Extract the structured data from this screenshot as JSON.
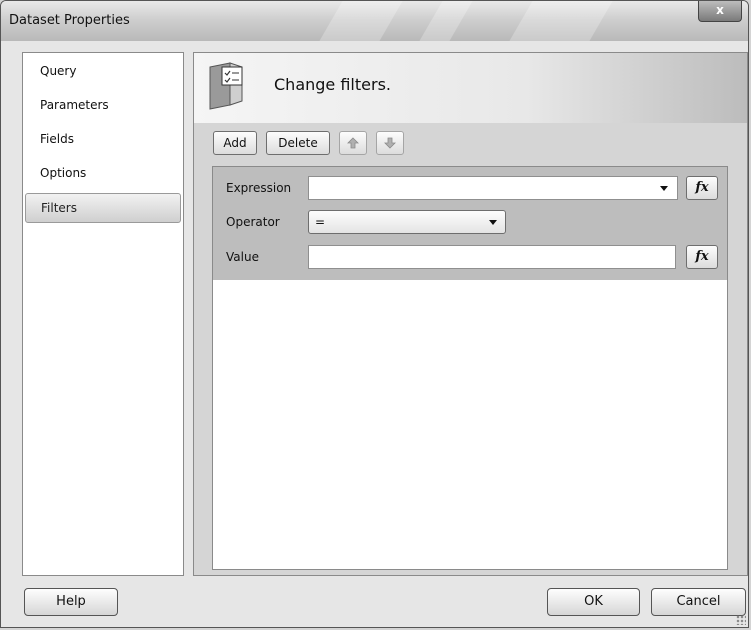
{
  "window": {
    "title": "Dataset Properties",
    "close_label": "x"
  },
  "nav": {
    "items": [
      {
        "label": "Query"
      },
      {
        "label": "Parameters"
      },
      {
        "label": "Fields"
      },
      {
        "label": "Options"
      },
      {
        "label": "Filters"
      }
    ],
    "selected": "Filters"
  },
  "page": {
    "title": "Change filters.",
    "icon": "filter-checklist-icon"
  },
  "toolbar": {
    "add_label": "Add",
    "delete_label": "Delete",
    "move_up_icon": "arrow-up-icon",
    "move_down_icon": "arrow-down-icon"
  },
  "filter": {
    "expression_label": "Expression",
    "expression_value": "",
    "operator_label": "Operator",
    "operator_value": "=",
    "value_label": "Value",
    "value_value": "",
    "fx_label": "fx"
  },
  "footer": {
    "help_label": "Help",
    "ok_label": "OK",
    "cancel_label": "Cancel"
  }
}
